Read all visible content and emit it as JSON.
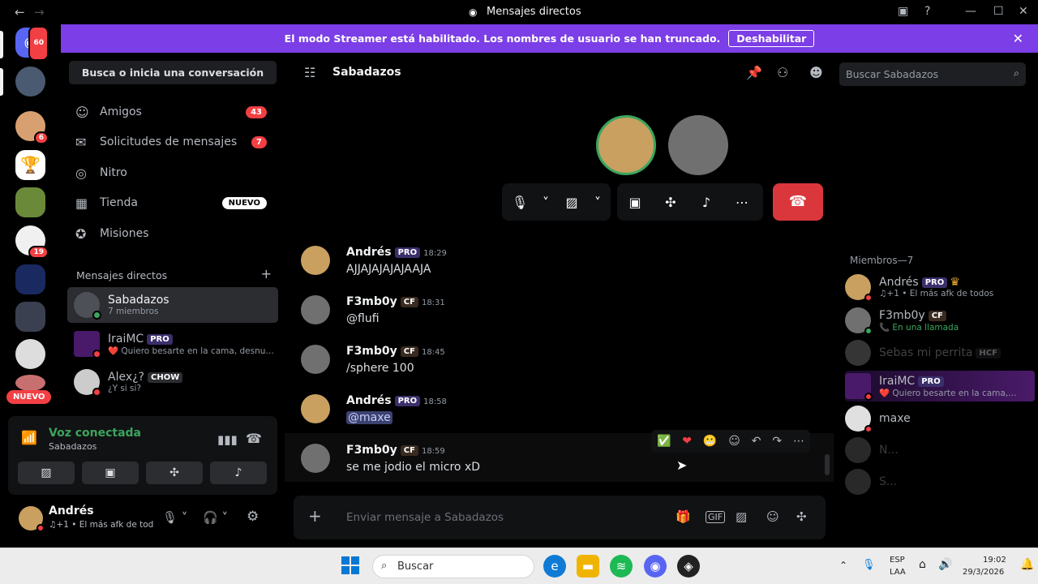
{
  "window": {
    "title": "Mensajes directos"
  },
  "banner": {
    "text": "El modo Streamer está habilitado. Los nombres de usuario se han truncado.",
    "button": "Deshabilitar"
  },
  "rail": {
    "badges": [
      "60",
      "6",
      "19"
    ],
    "nuevo": "NUEVO"
  },
  "sidebar": {
    "search": "Busca o inicia una conversación",
    "nav": [
      {
        "label": "Amigos",
        "icon": "friends-icon",
        "count": "43"
      },
      {
        "label": "Solicitudes de mensajes",
        "icon": "mail-icon",
        "count": "7"
      },
      {
        "label": "Nitro",
        "icon": "nitro-icon"
      },
      {
        "label": "Tienda",
        "icon": "shop-icon",
        "badge": "NUEVO"
      },
      {
        "label": "Misiones",
        "icon": "quests-icon"
      }
    ],
    "dm_header": "Mensajes directos",
    "dms": [
      {
        "name": "Sabadazos",
        "sub": "7 miembros"
      },
      {
        "name": "IraiMC",
        "tag": "PRO",
        "sub": "❤️ Quiero besarte en la cama, desnuda o..."
      },
      {
        "name": "Alex¿?",
        "tag": "CHOW",
        "sub": "¿Y si si?"
      }
    ]
  },
  "voice": {
    "title": "Voz conectada",
    "channel": "Sabadazos"
  },
  "user": {
    "name": "Andrés",
    "status": "♫+1 • El más afk de tod"
  },
  "channel": {
    "name": "Sabadazos",
    "search_placeholder": "Buscar Sabadazos"
  },
  "messages": [
    {
      "author": "Andrés",
      "tag": "PRO",
      "time": "18:29",
      "text": "AJJAJAJAJAJAAJA"
    },
    {
      "author": "F3mb0y",
      "tag": "CF",
      "time": "18:31",
      "text": "@flufi"
    },
    {
      "author": "F3mb0y",
      "tag": "CF",
      "time": "18:45",
      "text": "/sphere 100"
    },
    {
      "author": "Andrés",
      "tag": "PRO",
      "time": "18:58",
      "text": "@maxe"
    },
    {
      "author": "F3mb0y",
      "tag": "CF",
      "time": "18:59",
      "text": "se me jodio el micro xD"
    }
  ],
  "composer": {
    "placeholder": "Enviar mensaje a Sabadazos"
  },
  "members": {
    "header": "Miembros—7",
    "list": [
      {
        "name": "Andrés",
        "tag": "PRO",
        "sub": "♫+1 • El más afk de todos"
      },
      {
        "name": "F3mb0y",
        "tag": "CF",
        "sub": "📞 En una llamada"
      },
      {
        "name": "Sebas mi perrita",
        "tag": "HCF",
        "sub": ""
      },
      {
        "name": "IraiMC",
        "tag": "PRO",
        "sub": "❤️ Quiero besarte en la cama, ..."
      },
      {
        "name": "maxe",
        "sub": ""
      },
      {
        "name": "N...",
        "sub": ""
      },
      {
        "name": "S...",
        "sub": ""
      }
    ]
  },
  "taskbar": {
    "search": "Buscar",
    "lang": "ESP",
    "layout": "LAA",
    "time": "19:02",
    "date": "29/3/2026"
  },
  "colors": {
    "accent": "#7c3ee6",
    "online": "#3ba55d",
    "danger": "#da373c"
  }
}
